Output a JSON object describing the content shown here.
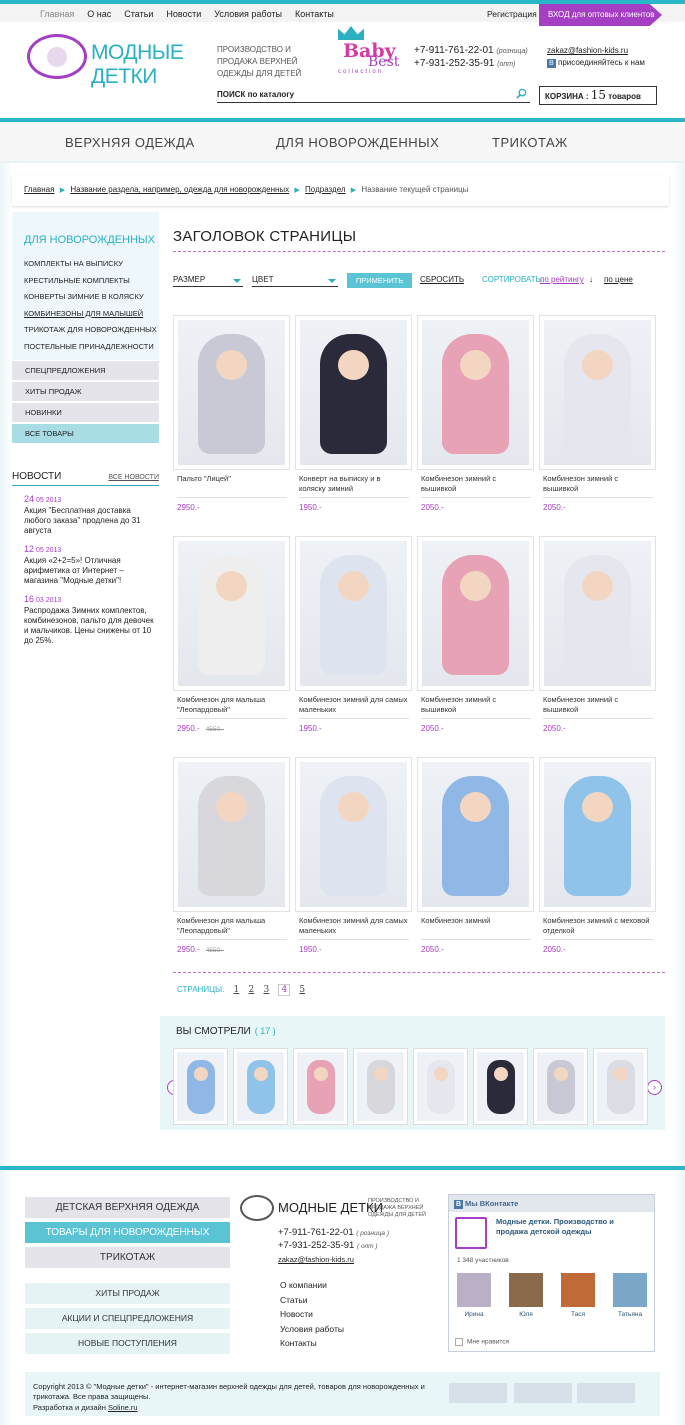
{
  "topnav": {
    "items": [
      "Главная",
      "О нас",
      "Статьи",
      "Новости",
      "Условия работы",
      "Контакты"
    ],
    "register": "Регистрация",
    "wholesale": "ВХОД для оптовых клиентов"
  },
  "brand": {
    "name": "МОДНЫЕ ДЕТКИ",
    "tagline": "ПРОИЗВОДСТВО И ПРОДАЖА ВЕРХНЕЙ ОДЕЖДЫ ДЛЯ ДЕТЕЙ",
    "sub_baby": "Baby",
    "sub_best": "Best",
    "sub_coll": "collection"
  },
  "phones": [
    {
      "num": "+7-911-761-22-01",
      "note": "(розница)"
    },
    {
      "num": "+7-931-252-35-91",
      "note": "(опт)"
    }
  ],
  "contact": {
    "email": "zakaz@fashion-kids.ru",
    "vk": "присоединяйтесь к нам"
  },
  "search": {
    "label": "ПОИСК по каталогу"
  },
  "cart": {
    "label": "КОРЗИНА :",
    "count": "15",
    "unit": "товаров"
  },
  "categories": [
    "ВЕРХНЯЯ ОДЕЖДА",
    "ДЛЯ НОВОРОЖДЕННЫХ",
    "ТРИКОТАЖ"
  ],
  "breadcrumb": [
    "Главная",
    "Название раздела, например, одежда для новорожденных",
    "Подраздел",
    "Название текущей страницы"
  ],
  "sidebar": {
    "title": "ДЛЯ НОВОРОЖДЕННЫХ",
    "items": [
      "КОМПЛЕКТЫ НА ВЫПИСКУ",
      "КРЕСТИЛЬНЫЕ КОМПЛЕКТЫ",
      "КОНВЕРТЫ ЗИМНИЕ В КОЛЯСКУ",
      "КОМБИНЕЗОНЫ ДЛЯ МАЛЫШЕЙ",
      "ТРИКОТАЖ ДЛЯ НОВОРОЖДЕННЫХ",
      "ПОСТЕЛЬНЫЕ ПРИНАДЛЕЖНОСТИ"
    ],
    "buttons": [
      "СПЕЦПРЕДЛОЖЕНИЯ",
      "ХИТЫ ПРОДАЖ",
      "НОВИНКИ",
      "ВСЕ ТОВАРЫ"
    ]
  },
  "news": {
    "title": "НОВОСТИ",
    "all": "ВСЕ НОВОСТИ",
    "items": [
      {
        "day": "24",
        "date": "05 2013",
        "text": "Акция \"Бесплатная доставка любого заказа\" продлена до 31 августа"
      },
      {
        "day": "12",
        "date": "05 2013",
        "text": "Акция «2+2=5»! Отличная арифметика от Интернет – магазина \"Модные детки\"!"
      },
      {
        "day": "16",
        "date": "03 2013",
        "text": "Распродажа Зимних комплектов, комбинезонов, пальто для девочек и мальчиков. Цены снижены от 10 до 25%."
      }
    ]
  },
  "page": {
    "title": "ЗАГОЛОВОК СТРАНИЦЫ"
  },
  "filters": {
    "size": "РАЗМЕР",
    "color": "ЦВЕТ",
    "apply": "ПРИМЕНИТЬ",
    "reset": "СБРОСИТЬ",
    "sort_label": "СОРТИРОВАТЬ:",
    "sort_rating": "по рейтингу",
    "sort_arrow": "↓",
    "sort_price": "по цене"
  },
  "products": [
    {
      "name": "Пальто \"Лицей\"",
      "price": "2950.-",
      "old": "",
      "color": "#c9c9d6"
    },
    {
      "name": "Конверт на выписку и в коляску зимний",
      "price": "1950.-",
      "old": "",
      "color": "#2a2a3a"
    },
    {
      "name": "Комбинезон зимний с вышивкой",
      "price": "2050.-",
      "old": "",
      "color": "#e8a2b6"
    },
    {
      "name": "Комбинезон зимний с вышивкой",
      "price": "2050.-",
      "old": "",
      "color": "#e6e6ee"
    },
    {
      "name": "Комбинезон для малыша \"Леопардовый\"",
      "price": "2950.-",
      "old": "4550.-",
      "color": "#eeeeee"
    },
    {
      "name": "Комбинезон зимний для самых маленьких",
      "price": "1950.-",
      "old": "",
      "color": "#dde4f0"
    },
    {
      "name": "Комбинезон зимний с вышивкой",
      "price": "2050.-",
      "old": "",
      "color": "#e8a2b6"
    },
    {
      "name": "Комбинезон зимний с вышивкой",
      "price": "2050.-",
      "old": "",
      "color": "#e6e6ee"
    },
    {
      "name": "Комбинезон для малыша \"Леопардовый\"",
      "price": "2950.-",
      "old": "4550.-",
      "color": "#d8d8dc"
    },
    {
      "name": "Комбинезон зимний для самых маленьких",
      "price": "1950.-",
      "old": "",
      "color": "#dde4f0"
    },
    {
      "name": "Комбинезон зимний",
      "price": "2050.-",
      "old": "",
      "color": "#8fb8e6"
    },
    {
      "name": "Комбинезон зимний с меховой отделкой",
      "price": "2050.-",
      "old": "",
      "color": "#8fc3ea"
    }
  ],
  "pagination": {
    "label": "СТРАНИЦЫ:",
    "pages": [
      "1",
      "2",
      "3",
      "4",
      "5"
    ],
    "current": "4"
  },
  "viewed": {
    "title": "ВЫ СМОТРЕЛИ",
    "count": "( 17 )",
    "thumbs": [
      "#8fb8e6",
      "#8fc3ea",
      "#e8a2b6",
      "#d8d8dc",
      "#e6e6ee",
      "#2a2a3a",
      "#c9c9d6",
      "#dcdce4"
    ]
  },
  "footer": {
    "menu": [
      "ДЕТСКАЯ ВЕРХНЯЯ ОДЕЖДА",
      "ТОВАРЫ ДЛЯ НОВОРОЖДЕННЫХ",
      "ТРИКОТАЖ",
      "ХИТЫ ПРОДАЖ",
      "АКЦИИ И СПЕЦПРЕДЛОЖЕНИЯ",
      "НОВЫЕ ПОСТУПЛЕНИЯ"
    ],
    "brand": "МОДНЫЕ ДЕТКИ",
    "tagline": "ПРОИЗВОДСТВО И ПРОДАЖА ВЕРХНЕЙ ОДЕЖДЫ ДЛЯ ДЕТЕЙ",
    "phone1": "+7-911-761-22-01",
    "note1": "( розница )",
    "phone2": "+7-931-252-35-91",
    "note2": "( опт )",
    "email": "zakaz@fashion-kids.ru",
    "links": [
      "О компании",
      "Статьи",
      "Новости",
      "Условия работы",
      "Контакты"
    ],
    "copyright": "Copyright 2013 © \"Модные детки\" - интернет-магазин верхней одежды для детей, товаров для новорожденных и трикотажа. Все права защищены.",
    "dev_label": "Разработка и дизайн",
    "dev": "Soline.ru"
  },
  "vk": {
    "header": "Мы ВКонтакте",
    "group": "Модные детки. Производство и продажа детской одежды",
    "members": "1 348 участников",
    "users": [
      "Ирина",
      "Юля",
      "Тася",
      "Татьяна"
    ],
    "like": "Мне нравится"
  }
}
